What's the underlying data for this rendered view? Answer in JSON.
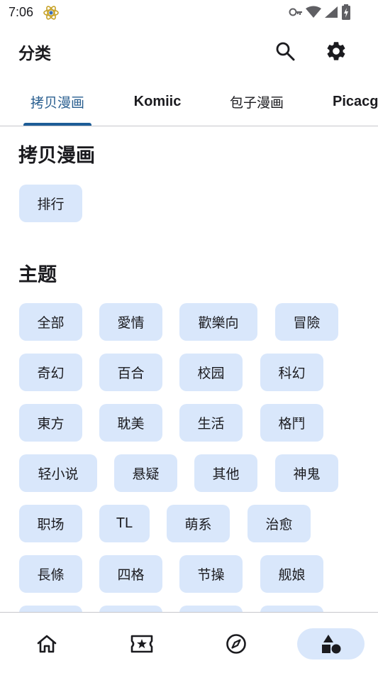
{
  "status_bar": {
    "time": "7:06"
  },
  "app_bar": {
    "title": "分类",
    "search_icon": "search-icon",
    "settings_icon": "gear-icon"
  },
  "tabs": [
    {
      "label": "拷贝漫画",
      "active": true
    },
    {
      "label": "Komiic",
      "active": false
    },
    {
      "label": "包子漫画",
      "active": false
    },
    {
      "label": "Picacg",
      "active": false
    }
  ],
  "sections": [
    {
      "title": "拷贝漫画",
      "chips": [
        "排行"
      ]
    },
    {
      "title": "主题",
      "chips": [
        "全部",
        "愛情",
        "歡樂向",
        "冒險",
        "奇幻",
        "百合",
        "校园",
        "科幻",
        "東方",
        "耽美",
        "生活",
        "格鬥",
        "轻小说",
        "悬疑",
        "其他",
        "神鬼",
        "职场",
        "TL",
        "萌系",
        "治愈",
        "長條",
        "四格",
        "节操",
        "舰娘"
      ]
    }
  ],
  "bottom_nav": [
    {
      "name": "home",
      "icon": "home-icon",
      "active": false
    },
    {
      "name": "favorites",
      "icon": "ticket-star-icon",
      "active": false
    },
    {
      "name": "explore",
      "icon": "compass-icon",
      "active": false
    },
    {
      "name": "categories",
      "icon": "shapes-icon",
      "active": true
    }
  ],
  "colors": {
    "accent": "#1d5d97",
    "chip_bg": "#d9e7fb",
    "text": "#1b1b1f",
    "divider": "#c7c7cc"
  }
}
